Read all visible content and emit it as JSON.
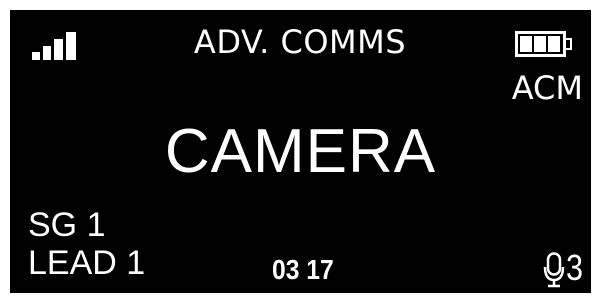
{
  "header": {
    "signal_icon": "signal-strength-icon",
    "title": "ADV. COMMS",
    "battery_icon": "battery-icon",
    "battery_level": 0.75
  },
  "mode_label": "ACM",
  "main_label": "CAMERA",
  "footer": {
    "group": "SG 1",
    "role": "LEAD 1",
    "time": "03 17",
    "mic_icon": "microphone-icon",
    "mic_count": "3"
  },
  "colors": {
    "background": "#000000",
    "foreground": "#ffffff"
  }
}
